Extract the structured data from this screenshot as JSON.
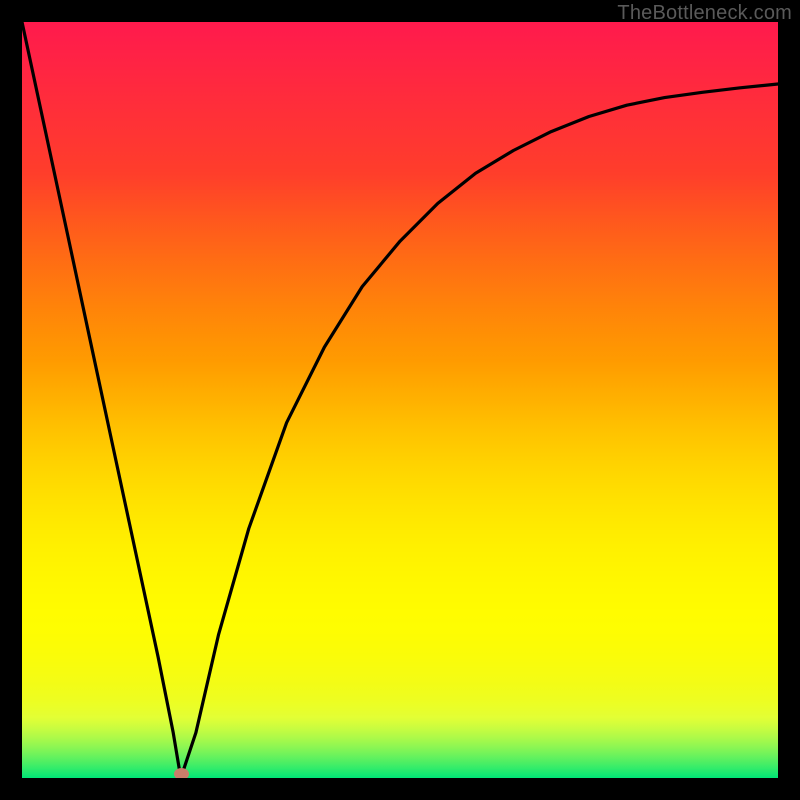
{
  "watermark": "TheBottleneck.com",
  "marker": {
    "x_frac": 0.21,
    "y_frac": 0.992
  },
  "chart_data": {
    "type": "line",
    "title": "",
    "xlabel": "",
    "ylabel": "",
    "xlim": [
      0,
      1
    ],
    "ylim": [
      0,
      1
    ],
    "grid": false,
    "legend": false,
    "background": "vertical-gradient red→orange→yellow→green",
    "series": [
      {
        "name": "bottleneck-curve",
        "x": [
          0.0,
          0.03,
          0.06,
          0.09,
          0.12,
          0.15,
          0.18,
          0.2,
          0.21,
          0.23,
          0.26,
          0.3,
          0.35,
          0.4,
          0.45,
          0.5,
          0.55,
          0.6,
          0.65,
          0.7,
          0.75,
          0.8,
          0.85,
          0.9,
          0.95,
          1.0
        ],
        "values": [
          1.0,
          0.86,
          0.72,
          0.58,
          0.44,
          0.3,
          0.16,
          0.06,
          0.0,
          0.06,
          0.19,
          0.33,
          0.47,
          0.57,
          0.65,
          0.71,
          0.76,
          0.8,
          0.83,
          0.855,
          0.875,
          0.89,
          0.9,
          0.907,
          0.913,
          0.918
        ]
      }
    ],
    "annotations": [
      {
        "type": "point",
        "x": 0.21,
        "y": 0.0,
        "label": "minimum-marker"
      }
    ]
  }
}
